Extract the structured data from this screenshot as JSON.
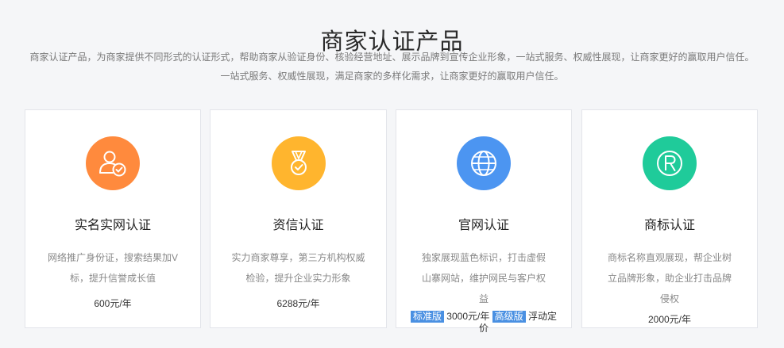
{
  "header": {
    "title": "商家认证产品",
    "intro_line1": "商家认证产品，为商家提供不同形式的认证形式，帮助商家从验证身份、核验经营地址、展示品牌到宣传企业形象，一站式服务、权威性展现，让商家更好的赢取用户信任。",
    "intro_line2": "一站式服务、权威性展现，满足商家的多样化需求，让商家更好的赢取用户信任。"
  },
  "colors": {
    "realname": "#ff8a3d",
    "credit": "#ffb52e",
    "website": "#4c95f1",
    "trademark": "#1fcb9a",
    "tag": "#4a90e2"
  },
  "cards": [
    {
      "icon": "user-check-icon",
      "title": "实名实网认证",
      "desc": "网络推广身份证，搜索结果加V标，提升信誉成长值",
      "price": "600元/年"
    },
    {
      "icon": "medal-icon",
      "title": "资信认证",
      "desc": "实力商家尊享，第三方机构权威检验，提升企业实力形象",
      "price": "6288元/年"
    },
    {
      "icon": "globe-icon",
      "title": "官网认证",
      "desc": "独家展现蓝色标识，打击虚假山寨网站，维护网民与客户权益",
      "tag_standard": "标准版",
      "price_standard": "3000元/年",
      "tag_premium": "高级版",
      "price_premium": "浮动定价"
    },
    {
      "icon": "registered-icon",
      "title": "商标认证",
      "desc": "商标名称直观展现，帮企业树立品牌形象，助企业打击品牌侵权",
      "price": "2000元/年"
    }
  ]
}
